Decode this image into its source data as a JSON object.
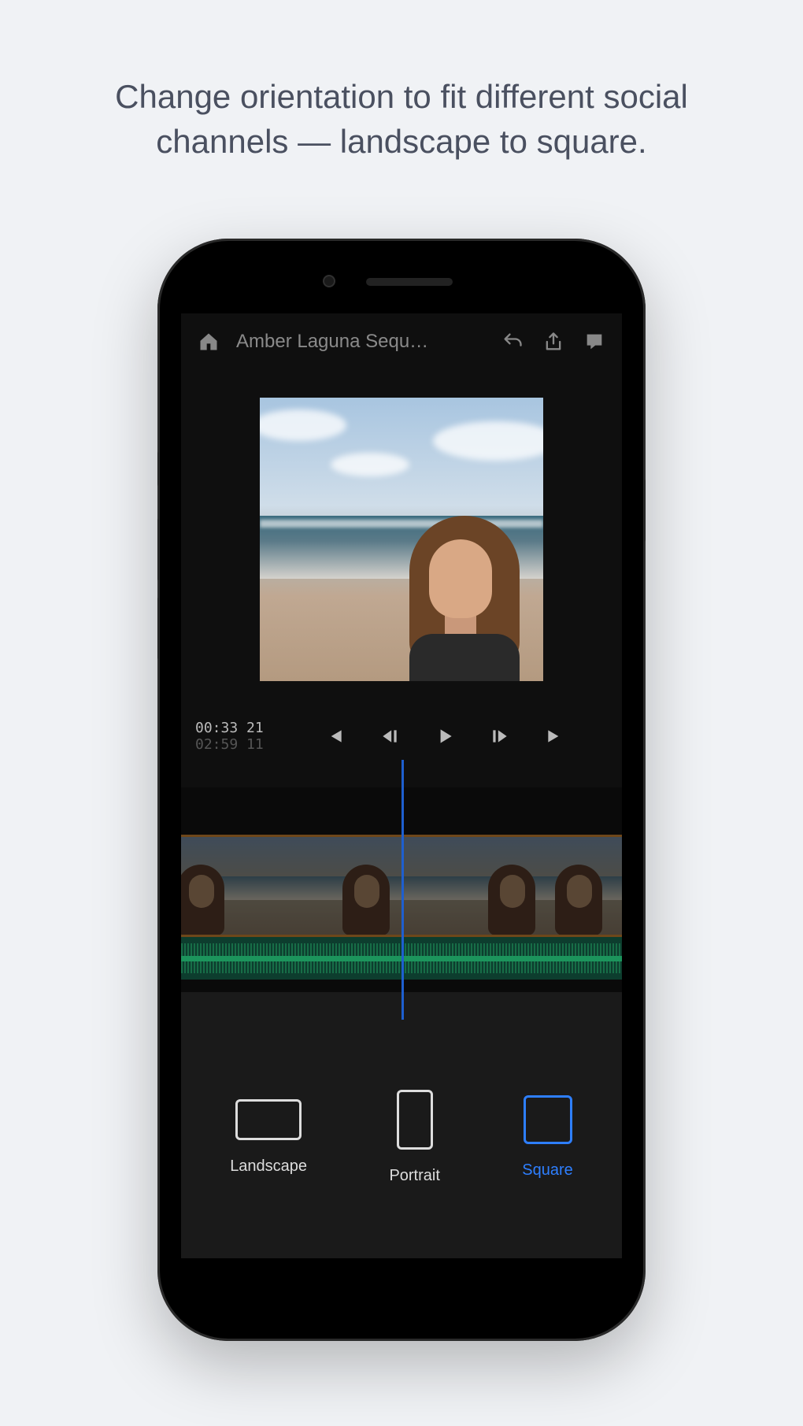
{
  "caption": "Change orientation to fit different social channels — landscape to square.",
  "topbar": {
    "project_title": "Amber Laguna Sequ…"
  },
  "playback": {
    "current_time": "00:33 21",
    "total_time": "02:59 11"
  },
  "orientation": {
    "options": {
      "landscape": "Landscape",
      "portrait": "Portrait",
      "square": "Square"
    },
    "selected": "square"
  },
  "icons": {
    "home": "home-icon",
    "undo": "undo-icon",
    "share": "share-icon",
    "comment": "comment-icon",
    "skip_start": "skip-start-icon",
    "step_back": "step-back-icon",
    "play": "play-icon",
    "step_fwd": "step-forward-icon",
    "skip_end": "skip-end-icon"
  }
}
